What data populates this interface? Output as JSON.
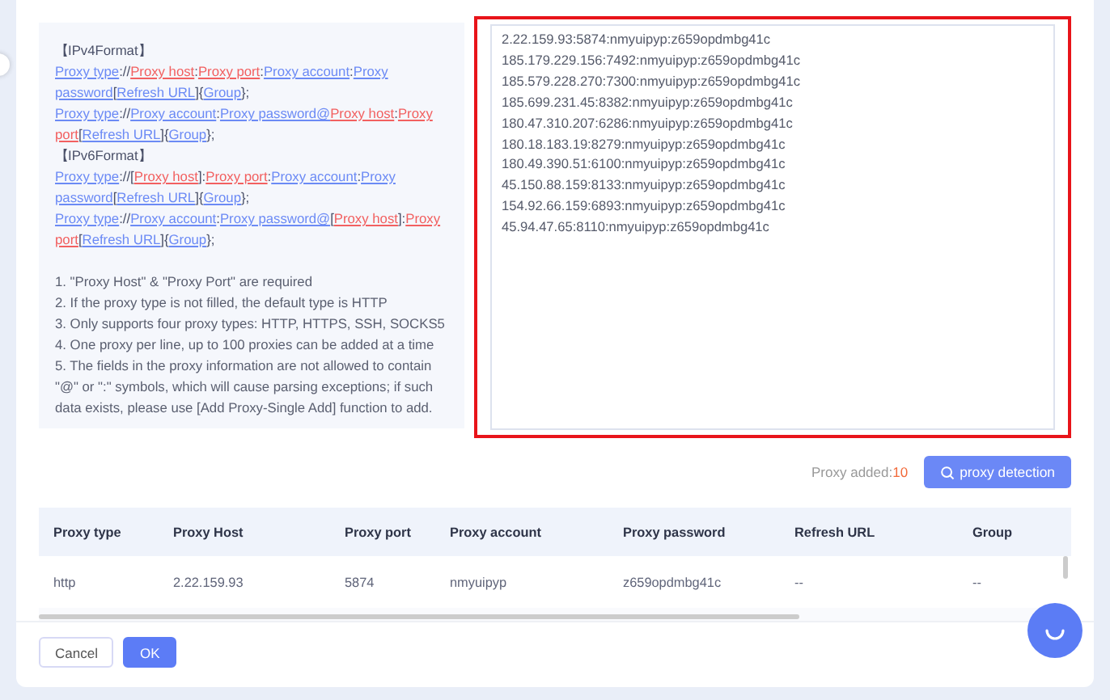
{
  "format_help": {
    "lines": [
      [
        {
          "text": "【IPv4Format】",
          "kind": "plain"
        }
      ],
      [
        {
          "text": "Proxy type",
          "kind": "blue"
        },
        {
          "text": "://",
          "kind": "plain"
        },
        {
          "text": "Proxy host",
          "kind": "red"
        },
        {
          "text": ":",
          "kind": "plain"
        },
        {
          "text": "Proxy port",
          "kind": "red"
        },
        {
          "text": ":",
          "kind": "plain"
        },
        {
          "text": "Proxy account",
          "kind": "blue"
        },
        {
          "text": ":",
          "kind": "plain"
        },
        {
          "text": "Proxy password",
          "kind": "blue"
        },
        {
          "text": "[",
          "kind": "plain"
        },
        {
          "text": "Refresh URL",
          "kind": "blue"
        },
        {
          "text": "]{",
          "kind": "plain"
        },
        {
          "text": "Group",
          "kind": "blue"
        },
        {
          "text": "};",
          "kind": "plain"
        }
      ],
      [
        {
          "text": "Proxy type",
          "kind": "blue"
        },
        {
          "text": "://",
          "kind": "plain"
        },
        {
          "text": "Proxy account",
          "kind": "blue"
        },
        {
          "text": ":",
          "kind": "plain"
        },
        {
          "text": "Proxy password@",
          "kind": "blue"
        },
        {
          "text": "Proxy host",
          "kind": "red"
        },
        {
          "text": ":",
          "kind": "plain"
        },
        {
          "text": "Proxy port",
          "kind": "red"
        },
        {
          "text": "[",
          "kind": "plain"
        },
        {
          "text": "Refresh URL",
          "kind": "blue"
        },
        {
          "text": "]{",
          "kind": "plain"
        },
        {
          "text": "Group",
          "kind": "blue"
        },
        {
          "text": "};",
          "kind": "plain"
        }
      ],
      [
        {
          "text": "【IPv6Format】",
          "kind": "plain"
        }
      ],
      [
        {
          "text": "Proxy type",
          "kind": "blue"
        },
        {
          "text": "://[",
          "kind": "plain"
        },
        {
          "text": "Proxy host",
          "kind": "red"
        },
        {
          "text": "]:",
          "kind": "plain"
        },
        {
          "text": "Proxy port",
          "kind": "red"
        },
        {
          "text": ":",
          "kind": "plain"
        },
        {
          "text": "Proxy account",
          "kind": "blue"
        },
        {
          "text": ":",
          "kind": "plain"
        },
        {
          "text": "Proxy password",
          "kind": "blue"
        },
        {
          "text": "[",
          "kind": "plain"
        },
        {
          "text": "Refresh URL",
          "kind": "blue"
        },
        {
          "text": "]{",
          "kind": "plain"
        },
        {
          "text": "Group",
          "kind": "blue"
        },
        {
          "text": "};",
          "kind": "plain"
        }
      ],
      [
        {
          "text": "Proxy type",
          "kind": "blue"
        },
        {
          "text": "://",
          "kind": "plain"
        },
        {
          "text": "Proxy account",
          "kind": "blue"
        },
        {
          "text": ":",
          "kind": "plain"
        },
        {
          "text": "Proxy password@",
          "kind": "blue"
        },
        {
          "text": "[",
          "kind": "plain"
        },
        {
          "text": "Proxy host",
          "kind": "red"
        },
        {
          "text": "]:",
          "kind": "plain"
        },
        {
          "text": "Proxy port",
          "kind": "red"
        },
        {
          "text": "[",
          "kind": "plain"
        },
        {
          "text": "Refresh URL",
          "kind": "blue"
        },
        {
          "text": "]{",
          "kind": "plain"
        },
        {
          "text": "Group",
          "kind": "blue"
        },
        {
          "text": "};",
          "kind": "plain"
        }
      ]
    ],
    "notes": [
      "1. \"Proxy Host\" & \"Proxy Port\" are required",
      "2. If the proxy type is not filled, the default type is HTTP",
      "3. Only supports four proxy types: HTTP, HTTPS, SSH, SOCKS5",
      "4. One proxy per line, up to 100 proxies can be added at a time",
      "5. The fields in the proxy information are not allowed to contain \"@\" or \":\" symbols, which will cause parsing exceptions; if such data exists, please use [Add Proxy-Single Add] function to add."
    ]
  },
  "proxy_input": {
    "error": true,
    "lines": [
      "2.22.159.93:5874:nmyuipyp:z659opdmbg41c",
      "185.179.229.156:7492:nmyuipyp:z659opdmbg41c",
      "185.579.228.270:7300:nmyuipyp:z659opdmbg41c",
      "185.699.231.45:8382:nmyuipyp:z659opdmbg41c",
      "180.47.310.207:6286:nmyuipyp:z659opdmbg41c",
      "180.18.183.19:8279:nmyuipyp:z659opdmbg41c",
      "180.49.390.51:6100:nmyuipyp:z659opdmbg41c",
      "45.150.88.159:8133:nmyuipyp:z659opdmbg41c",
      "154.92.66.159:6893:nmyuipyp:z659opdmbg41c",
      "45.94.47.65:8110:nmyuipyp:z659opdmbg41c"
    ]
  },
  "proxy_added": {
    "label": "Proxy added:",
    "count": "10"
  },
  "detect_button": "proxy detection",
  "table": {
    "columns": [
      "Proxy type",
      "Proxy Host",
      "Proxy port",
      "Proxy account",
      "Proxy password",
      "Refresh URL",
      "Group"
    ],
    "rows": [
      [
        "http",
        "2.22.159.93",
        "5874",
        "nmyuipyp",
        "z659opdmbg41c",
        "--",
        "--"
      ]
    ]
  },
  "buttons": [
    {
      "label": "Cancel",
      "kind": "secondary"
    },
    {
      "label": "OK",
      "kind": "primary"
    }
  ]
}
